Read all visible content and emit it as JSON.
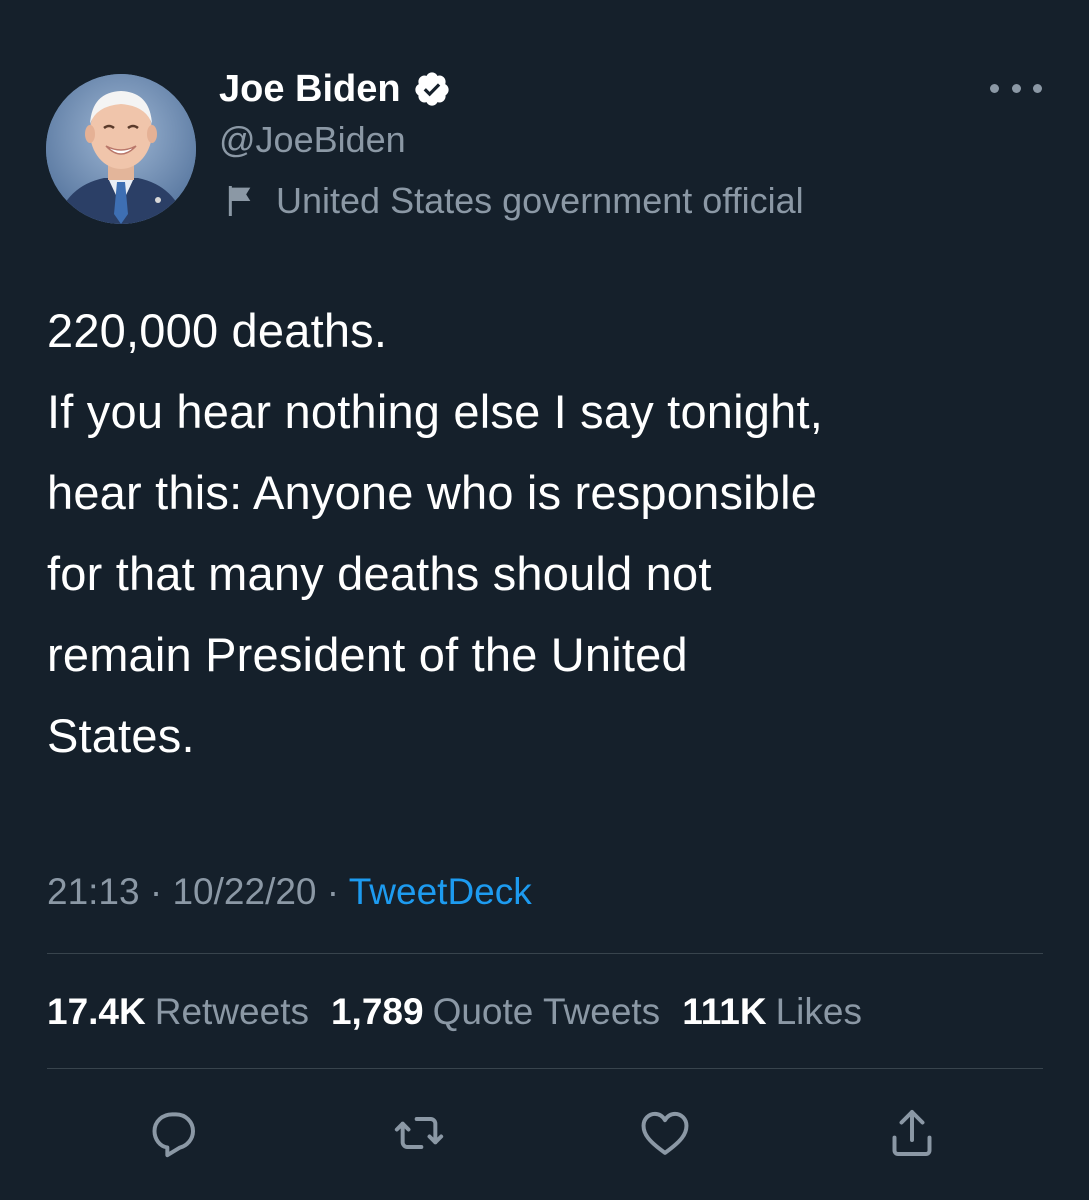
{
  "author": {
    "display_name": "Joe Biden",
    "handle": "@JoeBiden",
    "verified": true,
    "label": "United States government official"
  },
  "tweet": {
    "paragraph1": "220,000 deaths.",
    "paragraph2": "If you hear nothing else I say tonight,\nhear this: Anyone who is responsible\nfor that many deaths should not\nremain President of the United\nStates."
  },
  "meta": {
    "time": "21:13",
    "separator": "·",
    "date": "10/22/20",
    "source": "TweetDeck"
  },
  "stats": {
    "retweets_count": "17.4K",
    "retweets_label": "Retweets",
    "quote_count": "1,789",
    "quote_label": "Quote Tweets",
    "likes_count": "111K",
    "likes_label": "Likes"
  },
  "icons": {
    "verified": "verified-badge-icon",
    "label": "flag-icon",
    "more": "more-icon",
    "reply": "reply-icon",
    "retweet": "retweet-icon",
    "like": "heart-icon",
    "share": "share-icon"
  },
  "colors": {
    "background": "#15202b",
    "text": "#ffffff",
    "secondary_text": "#8b98a5",
    "link": "#1d9bf0",
    "divider": "#38444d"
  }
}
